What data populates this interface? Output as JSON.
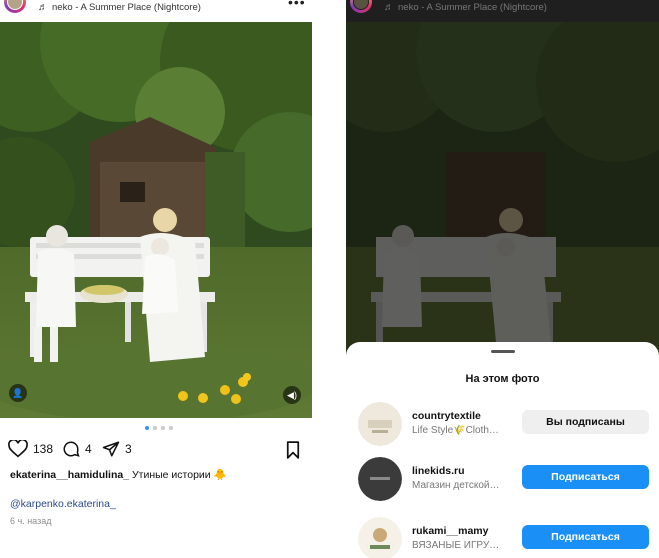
{
  "post": {
    "music": "neko - A Summer Place (Nightcore)",
    "likes": "138",
    "comments": "4",
    "shares": "3",
    "username": "ekaterina__hamidulina_",
    "caption_text": "Утиные истории",
    "caption_emoji": "🐥",
    "mention": "@karpenko.ekaterina_",
    "time": "6 ч. назад",
    "carousel_dots": 4,
    "active_dot": 0
  },
  "icons": [
    "music-note-icon",
    "more-icon",
    "heart-icon",
    "comment-icon",
    "send-icon",
    "bookmark-icon",
    "tag-user-icon",
    "sound-icon"
  ],
  "sheet": {
    "title": "На этом фото",
    "accounts": [
      {
        "name": "countrytextile",
        "subtitle": "Life Style🌾Cloth…",
        "button": "Вы подписаны",
        "state": "following"
      },
      {
        "name": "linekids.ru",
        "subtitle": "Магазин детской…",
        "button": "Подписаться",
        "state": "follow"
      },
      {
        "name": "rukami__mamy",
        "subtitle": "ВЯЗАНЫЕ ИГРУ…",
        "button": "Подписаться",
        "state": "follow"
      }
    ]
  },
  "colors": {
    "accent": "#1a8ff5",
    "link": "#2b4a8a",
    "following_bg": "#efefef"
  }
}
